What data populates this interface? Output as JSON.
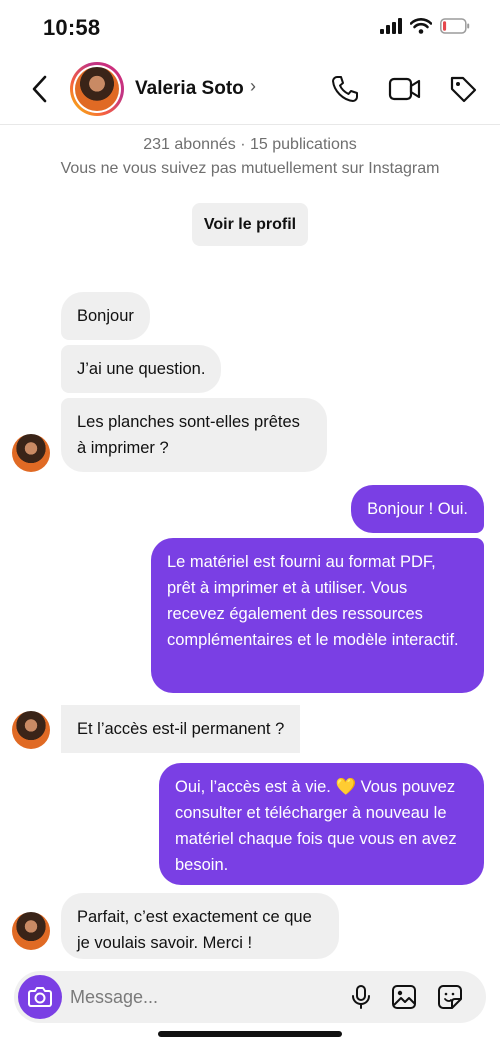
{
  "status_bar": {
    "time": "10:58",
    "battery_level": 0.15
  },
  "header": {
    "name": "Valeria Soto",
    "chevron": "›",
    "icons": [
      "back-chevron-icon",
      "phone-icon",
      "video-icon",
      "tag-icon"
    ]
  },
  "profile_info": {
    "stats": "231 abonnés · 15 publications",
    "mutual": "Vous ne vous suivez pas mutuellement sur Instagram",
    "button": "Voir le profil"
  },
  "messages": [
    {
      "from": "them",
      "text": "Bonjour"
    },
    {
      "from": "them",
      "text": "J’ai une question."
    },
    {
      "from": "them",
      "text": "Les planches sont-elles prêtes à imprimer ?"
    },
    {
      "from": "me",
      "text": "Bonjour ! Oui."
    },
    {
      "from": "me",
      "text": "Le matériel est fourni au format PDF, prêt à imprimer et à utiliser. Vous recevez également des ressources complémentaires et le modèle interactif."
    },
    {
      "from": "them",
      "text": "Et l’accès est-il permanent ?"
    },
    {
      "from": "me",
      "text": "Oui, l’accès est à vie. 💛 Vous pouvez consulter et télécharger à nouveau le matériel chaque fois que vous en avez besoin."
    },
    {
      "from": "them",
      "text": "Parfait, c’est exactement ce que je voulais savoir. Merci !"
    }
  ],
  "composer": {
    "placeholder": "Message..."
  },
  "colors": {
    "accent": "#7a3fe4",
    "incoming_bubble": "#efefef",
    "battery_low": "#e5484d"
  }
}
